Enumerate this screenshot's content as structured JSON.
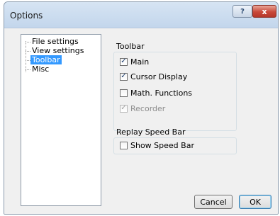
{
  "window": {
    "title": "Options"
  },
  "titlebar_buttons": {
    "help_icon": "?",
    "close_icon": "x"
  },
  "tree": {
    "items": [
      {
        "label": "File settings",
        "selected": false
      },
      {
        "label": "View settings",
        "selected": false
      },
      {
        "label": "Toolbar",
        "selected": true
      },
      {
        "label": "Misc",
        "selected": false
      }
    ]
  },
  "toolbar_group": {
    "title": "Toolbar",
    "options": [
      {
        "label": "Main",
        "checked": true,
        "enabled": true
      },
      {
        "label": "Cursor Display",
        "checked": true,
        "enabled": true
      },
      {
        "label": "Math. Functions",
        "checked": false,
        "enabled": true
      },
      {
        "label": "Recorder",
        "checked": true,
        "enabled": false
      }
    ]
  },
  "replay_group": {
    "title": "Replay Speed Bar",
    "options": [
      {
        "label": "Show Speed Bar",
        "checked": false,
        "enabled": true
      }
    ]
  },
  "buttons": {
    "cancel": "Cancel",
    "ok": "OK"
  },
  "check_glyph": "✓",
  "colors": {
    "selection": "#3399ff",
    "close_button": "#c9493a",
    "titlebar": "#c3d6ec"
  }
}
